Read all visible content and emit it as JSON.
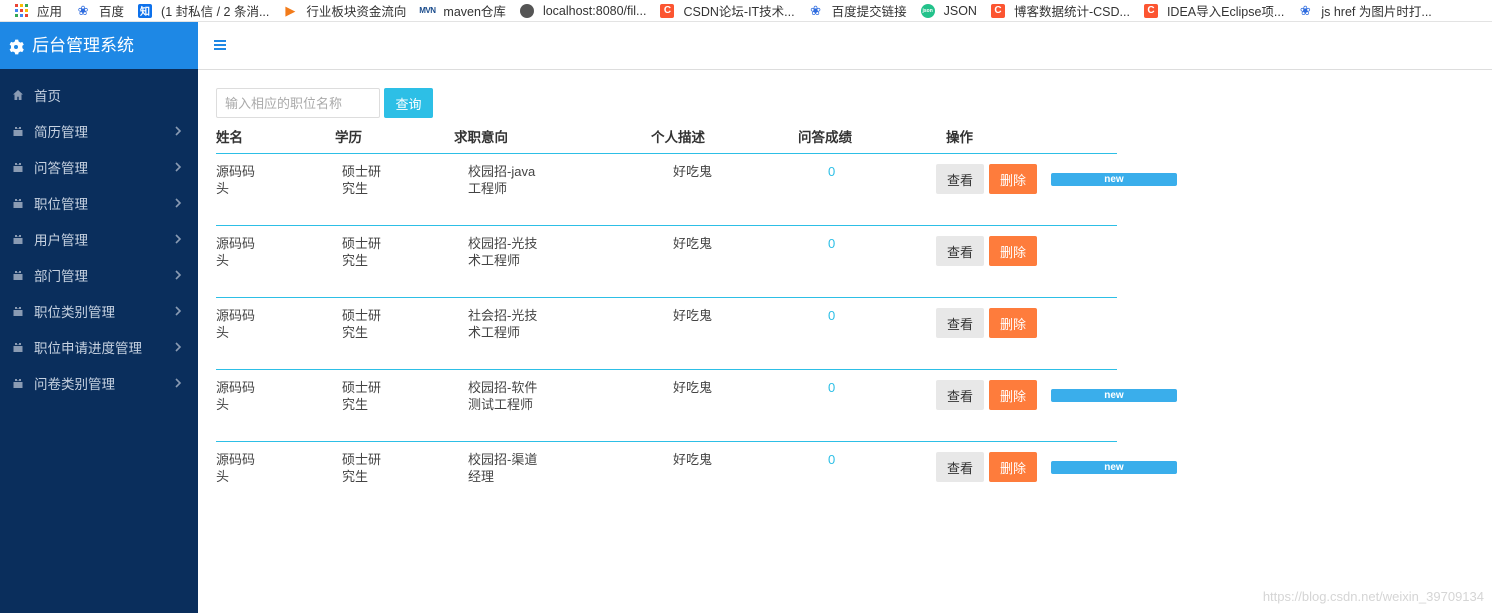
{
  "bookmarks": [
    {
      "label": "应用",
      "icon": "apps-grid-icon"
    },
    {
      "label": "百度",
      "icon": "baidu-paw-icon"
    },
    {
      "label": "(1 封私信 / 2 条消...",
      "icon": "zhihu-icon"
    },
    {
      "label": "行业板块资金流向",
      "icon": "flame-icon"
    },
    {
      "label": "maven仓库",
      "icon": "mvn-icon"
    },
    {
      "label": "localhost:8080/fil...",
      "icon": "globe-icon"
    },
    {
      "label": "CSDN论坛-IT技术...",
      "icon": "csdn-icon"
    },
    {
      "label": "百度提交链接",
      "icon": "baidu-paw-icon"
    },
    {
      "label": "JSON",
      "icon": "json-icon"
    },
    {
      "label": "博客数据统计-CSD...",
      "icon": "csdn-icon"
    },
    {
      "label": "IDEA导入Eclipse项...",
      "icon": "csdn-icon"
    },
    {
      "label": "js href 为图片时打...",
      "icon": "baidu-paw-icon"
    }
  ],
  "brand": {
    "title": "后台管理系统"
  },
  "menu": [
    {
      "label": "首页",
      "has_submenu": false
    },
    {
      "label": "简历管理",
      "has_submenu": true
    },
    {
      "label": "问答管理",
      "has_submenu": true
    },
    {
      "label": "职位管理",
      "has_submenu": true
    },
    {
      "label": "用户管理",
      "has_submenu": true
    },
    {
      "label": "部门管理",
      "has_submenu": true
    },
    {
      "label": "职位类别管理",
      "has_submenu": true
    },
    {
      "label": "职位申请进度管理",
      "has_submenu": true
    },
    {
      "label": "问卷类别管理",
      "has_submenu": true
    }
  ],
  "search": {
    "placeholder": "输入相应的职位名称",
    "value": "",
    "button_label": "查询"
  },
  "table": {
    "headers": [
      "姓名",
      "学历",
      "求职意向",
      "个人描述",
      "问答成绩",
      "操作"
    ],
    "rows": [
      {
        "name": "源码码头",
        "education": "硕士研究生",
        "intent": "校园招-java工程师",
        "description": "好吃鬼",
        "score": "0",
        "is_new": true
      },
      {
        "name": "源码码头",
        "education": "硕士研究生",
        "intent": "校园招-光技术工程师",
        "description": "好吃鬼",
        "score": "0",
        "is_new": false
      },
      {
        "name": "源码码头",
        "education": "硕士研究生",
        "intent": "社会招-光技术工程师",
        "description": "好吃鬼",
        "score": "0",
        "is_new": false
      },
      {
        "name": "源码码头",
        "education": "硕士研究生",
        "intent": "校园招-软件测试工程师",
        "description": "好吃鬼",
        "score": "0",
        "is_new": true
      },
      {
        "name": "源码码头",
        "education": "硕士研究生",
        "intent": "校园招-渠道经理",
        "description": "好吃鬼",
        "score": "0",
        "is_new": true
      }
    ],
    "view_label": "查看",
    "delete_label": "删除",
    "new_label": "new"
  },
  "watermark": "https://blog.csdn.net/weixin_39709134",
  "colors": {
    "sidebar": "#0a2e5c",
    "brand": "#1e88e5",
    "accent": "#2dbfe6",
    "delete": "#fe7c3c",
    "badge": "#3aaeeb"
  }
}
